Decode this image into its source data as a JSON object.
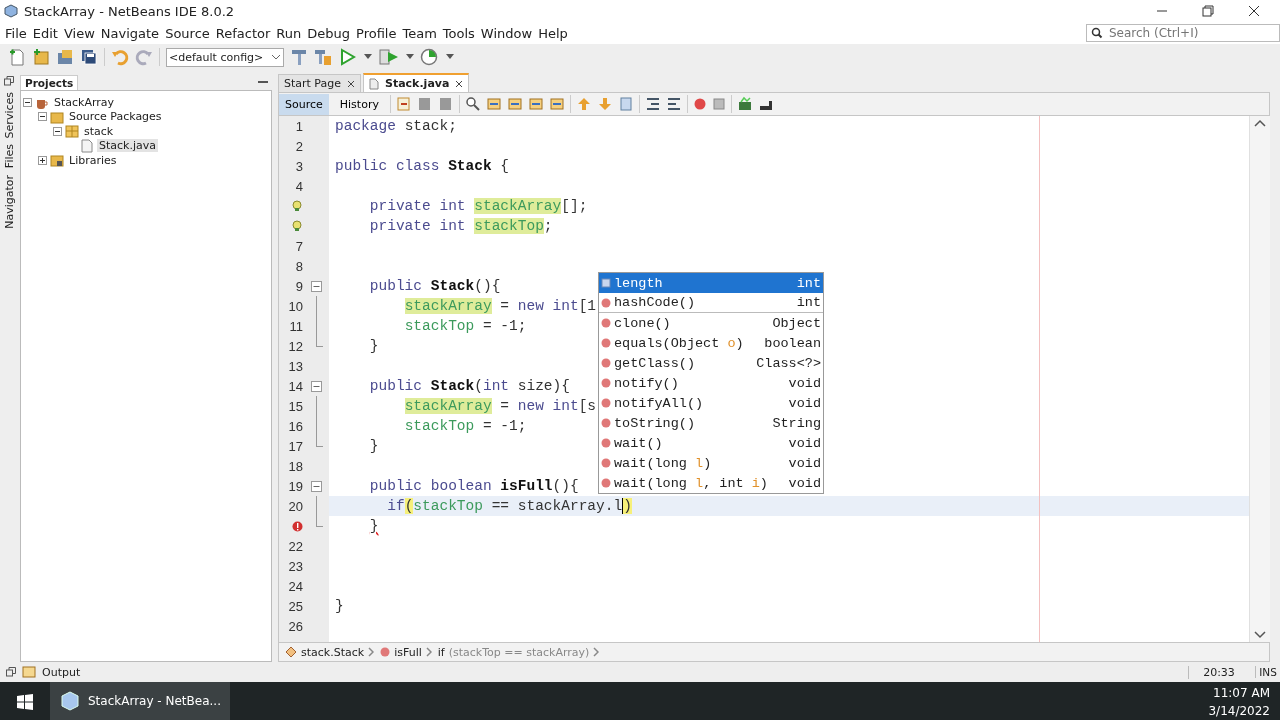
{
  "window": {
    "title": "StackArray - NetBeans IDE 8.0.2"
  },
  "menu": [
    "File",
    "Edit",
    "View",
    "Navigate",
    "Source",
    "Refactor",
    "Run",
    "Debug",
    "Profile",
    "Team",
    "Tools",
    "Window",
    "Help"
  ],
  "toolbar": {
    "config": "<default config>"
  },
  "search": {
    "placeholder": "Search (Ctrl+I)"
  },
  "side_tabs": [
    "Services",
    "Files",
    "Navigator"
  ],
  "projects_panel": {
    "title": "Projects",
    "tree": [
      {
        "kind": "project",
        "label": "StackArray",
        "expanded": true,
        "selected": false,
        "children": [
          {
            "kind": "source_folder",
            "label": "Source Packages",
            "expanded": true,
            "selected": false,
            "children": [
              {
                "kind": "package",
                "label": "stack",
                "expanded": true,
                "selected": false,
                "children": [
                  {
                    "kind": "java_file",
                    "label": "Stack.java",
                    "selected": true
                  }
                ]
              }
            ]
          },
          {
            "kind": "library",
            "label": "Libraries",
            "expanded": false,
            "selected": false
          }
        ]
      }
    ]
  },
  "editor": {
    "tabs": [
      {
        "label": "Start Page",
        "selected": false
      },
      {
        "label": "Stack.java",
        "selected": true
      }
    ],
    "view_tabs": [
      {
        "label": "Source",
        "selected": true
      },
      {
        "label": "History",
        "selected": false
      }
    ],
    "lines": [
      {
        "number": "1",
        "tokens": [
          {
            "text": "package",
            "kind": "keyword"
          },
          {
            "text": " stack;",
            "kind": "plain"
          }
        ]
      },
      {
        "number": "2"
      },
      {
        "number": "3",
        "tokens": [
          {
            "text": "public class ",
            "kind": "keyword"
          },
          {
            "text": "Stack",
            "kind": "bold"
          },
          {
            "text": " {",
            "kind": "plain"
          }
        ]
      },
      {
        "number": "4"
      },
      {
        "hint": true,
        "tokens": [
          {
            "text": "    private int ",
            "kind": "keyword"
          },
          {
            "text": "stackArray",
            "kind": "field",
            "highlight": true
          },
          {
            "text": "[];",
            "kind": "plain"
          }
        ]
      },
      {
        "hint": true,
        "tokens": [
          {
            "text": "    private int ",
            "kind": "keyword"
          },
          {
            "text": "stackTop",
            "kind": "field",
            "highlight": true
          },
          {
            "text": ";",
            "kind": "plain"
          }
        ]
      },
      {
        "number": "7"
      },
      {
        "number": "8"
      },
      {
        "number": "9",
        "fold_open": true,
        "tokens": [
          {
            "text": "    public ",
            "kind": "keyword"
          },
          {
            "text": "Stack",
            "kind": "bold"
          },
          {
            "text": "(){",
            "kind": "plain"
          }
        ]
      },
      {
        "number": "10",
        "fold_line": true,
        "tokens": [
          {
            "text": "        stackArray",
            "kind": "field",
            "highlight": true
          },
          {
            "text": " = ",
            "kind": "plain"
          },
          {
            "text": "new int",
            "kind": "keyword"
          },
          {
            "text": "[1",
            "kind": "plain"
          }
        ]
      },
      {
        "number": "11",
        "fold_line": true,
        "tokens": [
          {
            "text": "        stackTop",
            "kind": "field"
          },
          {
            "text": " = -1;",
            "kind": "plain"
          }
        ]
      },
      {
        "number": "12",
        "fold_end": true,
        "tokens": [
          {
            "text": "    }",
            "kind": "plain"
          }
        ]
      },
      {
        "number": "13"
      },
      {
        "number": "14",
        "fold_open": true,
        "tokens": [
          {
            "text": "    public ",
            "kind": "keyword"
          },
          {
            "text": "Stack",
            "kind": "bold"
          },
          {
            "text": "(",
            "kind": "plain"
          },
          {
            "text": "int",
            "kind": "keyword"
          },
          {
            "text": " size){",
            "kind": "plain"
          }
        ]
      },
      {
        "number": "15",
        "fold_line": true,
        "tokens": [
          {
            "text": "        stackArray",
            "kind": "field",
            "highlight": true
          },
          {
            "text": " = ",
            "kind": "plain"
          },
          {
            "text": "new int",
            "kind": "keyword"
          },
          {
            "text": "[s",
            "kind": "plain"
          }
        ]
      },
      {
        "number": "16",
        "fold_line": true,
        "tokens": [
          {
            "text": "        stackTop",
            "kind": "field"
          },
          {
            "text": " = -1;",
            "kind": "plain"
          }
        ]
      },
      {
        "number": "17",
        "fold_end": true,
        "tokens": [
          {
            "text": "    }",
            "kind": "plain"
          }
        ]
      },
      {
        "number": "18"
      },
      {
        "number": "19",
        "fold_open": true,
        "tokens": [
          {
            "text": "    public boolean ",
            "kind": "keyword"
          },
          {
            "text": "isFull",
            "kind": "bold"
          },
          {
            "text": "(){",
            "kind": "plain"
          }
        ]
      },
      {
        "number": "20",
        "fold_line": true,
        "current": true,
        "tokens": [
          {
            "text": "      if",
            "kind": "keyword"
          },
          {
            "text": "(",
            "kind": "plain",
            "match": true
          },
          {
            "text": "stackTop",
            "kind": "field"
          },
          {
            "text": " == stackArray.l",
            "kind": "plain",
            "caret_after": true
          },
          {
            "text": ")",
            "kind": "plain",
            "match": true
          }
        ]
      },
      {
        "error_mark": true,
        "fold_end": true,
        "tokens": [
          {
            "text": "    }",
            "kind": "plain",
            "error": true
          }
        ]
      },
      {
        "number": "22"
      },
      {
        "number": "23"
      },
      {
        "number": "24"
      },
      {
        "number": "25",
        "tokens": [
          {
            "text": "}",
            "kind": "plain"
          }
        ]
      },
      {
        "number": "26"
      }
    ],
    "completion": {
      "items": [
        {
          "kind": "field",
          "parts": [
            {
              "text": "length"
            }
          ],
          "type": "int",
          "selected": true
        },
        {
          "kind": "method",
          "parts": [
            {
              "text": "hashCode()"
            }
          ],
          "type": "int",
          "selected": false,
          "separator_after": true
        },
        {
          "kind": "method",
          "parts": [
            {
              "text": "clone()"
            }
          ],
          "type": "Object",
          "selected": false
        },
        {
          "kind": "method",
          "parts": [
            {
              "text": "equals(Object "
            },
            {
              "text": "o",
              "param": true
            },
            {
              "text": ")"
            }
          ],
          "type": "boolean",
          "selected": false
        },
        {
          "kind": "method",
          "parts": [
            {
              "text": "getClass()"
            }
          ],
          "type": "Class<?>",
          "selected": false
        },
        {
          "kind": "method",
          "parts": [
            {
              "text": "notify()"
            }
          ],
          "type": "void",
          "selected": false
        },
        {
          "kind": "method",
          "parts": [
            {
              "text": "notifyAll()"
            }
          ],
          "type": "void",
          "selected": false
        },
        {
          "kind": "method",
          "parts": [
            {
              "text": "toString()"
            }
          ],
          "type": "String",
          "selected": false
        },
        {
          "kind": "method",
          "parts": [
            {
              "text": "wait()"
            }
          ],
          "type": "void",
          "selected": false
        },
        {
          "kind": "method",
          "parts": [
            {
              "text": "wait(long "
            },
            {
              "text": "l",
              "param": true
            },
            {
              "text": ")"
            }
          ],
          "type": "void",
          "selected": false
        },
        {
          "kind": "method",
          "parts": [
            {
              "text": "wait(long "
            },
            {
              "text": "l",
              "param": true
            },
            {
              "text": ", int "
            },
            {
              "text": "i",
              "param": true
            },
            {
              "text": ")"
            }
          ],
          "type": "void",
          "selected": false
        }
      ]
    },
    "breadcrumb": [
      {
        "kind": "class",
        "label": "stack.Stack"
      },
      {
        "kind": "method",
        "label": "isFull"
      },
      {
        "kind": "statement",
        "label": "if",
        "detail": "(stackTop == stackArray)"
      }
    ]
  },
  "output": {
    "label": "Output"
  },
  "status_bar": {
    "position": "20:33",
    "mode": "INS"
  },
  "taskbar": {
    "app": "StackArray - NetBea...",
    "time": "11:07 AM",
    "date": "3/14/2022"
  }
}
